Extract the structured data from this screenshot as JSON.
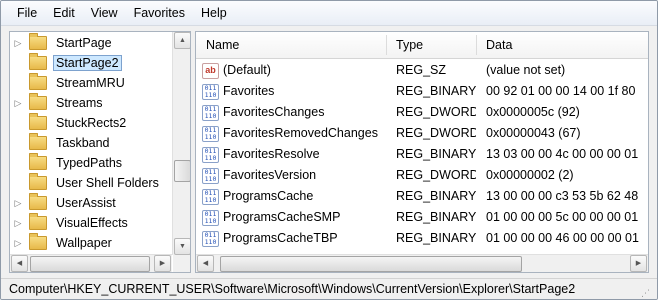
{
  "menu": [
    "File",
    "Edit",
    "View",
    "Favorites",
    "Help"
  ],
  "tree": {
    "items": [
      {
        "label": "StartPage",
        "expander": "▷",
        "selected": false
      },
      {
        "label": "StartPage2",
        "expander": "",
        "selected": true
      },
      {
        "label": "StreamMRU",
        "expander": "",
        "selected": false
      },
      {
        "label": "Streams",
        "expander": "▷",
        "selected": false
      },
      {
        "label": "StuckRects2",
        "expander": "",
        "selected": false
      },
      {
        "label": "Taskband",
        "expander": "",
        "selected": false
      },
      {
        "label": "TypedPaths",
        "expander": "",
        "selected": false
      },
      {
        "label": "User Shell Folders",
        "expander": "",
        "selected": false
      },
      {
        "label": "UserAssist",
        "expander": "▷",
        "selected": false
      },
      {
        "label": "VisualEffects",
        "expander": "▷",
        "selected": false
      },
      {
        "label": "Wallpaper",
        "expander": "▷",
        "selected": false
      }
    ]
  },
  "list": {
    "columns": {
      "name": "Name",
      "type": "Type",
      "data": "Data"
    },
    "rows": [
      {
        "icon": "string-value-icon",
        "name": "(Default)",
        "type": "REG_SZ",
        "data": "(value not set)"
      },
      {
        "icon": "binary-value-icon",
        "name": "Favorites",
        "type": "REG_BINARY",
        "data": "00 92 01 00 00 14 00 1f 80"
      },
      {
        "icon": "binary-value-icon",
        "name": "FavoritesChanges",
        "type": "REG_DWORD",
        "data": "0x0000005c (92)"
      },
      {
        "icon": "binary-value-icon",
        "name": "FavoritesRemovedChanges",
        "type": "REG_DWORD",
        "data": "0x00000043 (67)"
      },
      {
        "icon": "binary-value-icon",
        "name": "FavoritesResolve",
        "type": "REG_BINARY",
        "data": "13 03 00 00 4c 00 00 00 01"
      },
      {
        "icon": "binary-value-icon",
        "name": "FavoritesVersion",
        "type": "REG_DWORD",
        "data": "0x00000002 (2)"
      },
      {
        "icon": "binary-value-icon",
        "name": "ProgramsCache",
        "type": "REG_BINARY",
        "data": "13 00 00 00 c3 53 5b 62 48"
      },
      {
        "icon": "binary-value-icon",
        "name": "ProgramsCacheSMP",
        "type": "REG_BINARY",
        "data": "01 00 00 00 5c 00 00 00 01"
      },
      {
        "icon": "binary-value-icon",
        "name": "ProgramsCacheTBP",
        "type": "REG_BINARY",
        "data": "01 00 00 00 46 00 00 00 01"
      }
    ]
  },
  "status": {
    "path": "Computer\\HKEY_CURRENT_USER\\Software\\Microsoft\\Windows\\CurrentVersion\\Explorer\\StartPage2"
  }
}
